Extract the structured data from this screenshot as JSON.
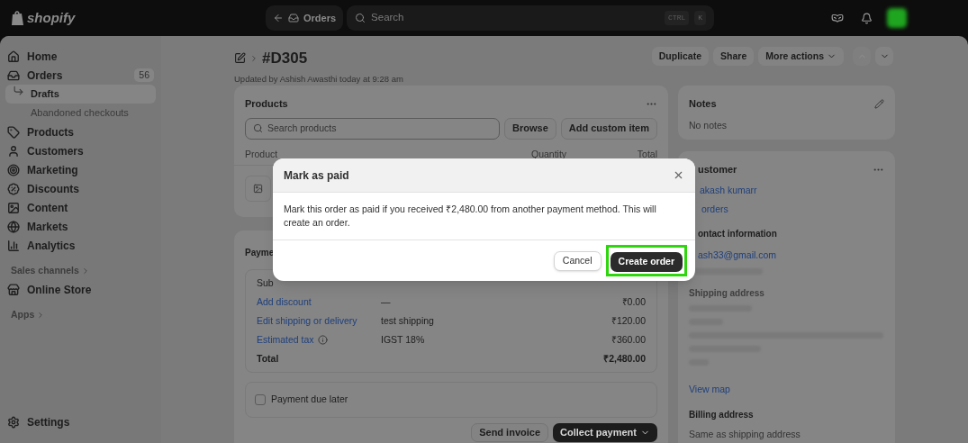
{
  "topbar": {
    "brand": "shopify",
    "back_label": "Orders",
    "search": {
      "placeholder": "Search"
    },
    "shortcut": [
      "CTRL",
      "K"
    ]
  },
  "sidebar": {
    "items": [
      {
        "label": "Home",
        "selected": false
      },
      {
        "label": "Orders",
        "badge": "56",
        "selected": false,
        "children": [
          {
            "label": "Drafts",
            "selected": true
          },
          {
            "label": "Abandoned checkouts",
            "selected": false
          }
        ]
      },
      {
        "label": "Products",
        "selected": false
      },
      {
        "label": "Customers",
        "selected": false
      },
      {
        "label": "Marketing",
        "selected": false
      },
      {
        "label": "Discounts",
        "selected": false
      },
      {
        "label": "Content",
        "selected": false
      },
      {
        "label": "Markets",
        "selected": false
      },
      {
        "label": "Analytics",
        "selected": false
      }
    ],
    "sections": [
      {
        "label": "Sales channels",
        "items": [
          {
            "label": "Online Store",
            "selected": false
          }
        ]
      },
      {
        "label": "Apps"
      }
    ],
    "footer_item": {
      "label": "Settings",
      "selected": false
    }
  },
  "header": {
    "title": "#D305",
    "subtitle": "Updated by Ashish Awasthi today at 9:28 am",
    "actions": [
      {
        "label": "Duplicate",
        "menu": false
      },
      {
        "label": "Share",
        "menu": false
      },
      {
        "label": "More actions",
        "menu": true
      }
    ],
    "prev": {
      "disabled": true
    },
    "next": {
      "disabled": false
    }
  },
  "products": {
    "title": "Products",
    "search": {
      "placeholder": "Search products"
    },
    "buttons": [
      "Browse",
      "Add custom item"
    ],
    "columns": [
      "Product",
      "Quantity",
      "Total"
    ]
  },
  "payment": {
    "title": "Payme",
    "rows": [
      {
        "kind": "plain",
        "label": "Sub"
      },
      {
        "kind": "link",
        "label": "Add discount",
        "detail": "—",
        "amount": "₹0.00"
      },
      {
        "kind": "link",
        "label": "Edit shipping or delivery",
        "detail": "test shipping",
        "amount": "₹120.00"
      },
      {
        "kind": "link",
        "label": "Estimated tax",
        "info": true,
        "detail": "IGST 18%",
        "amount": "₹360.00"
      },
      {
        "kind": "total",
        "label": "Total",
        "amount": "₹2,480.00"
      }
    ],
    "due_later": {
      "label": "Payment due later",
      "checked": false
    },
    "send_label": "Send invoice",
    "collect_label": "Collect payment"
  },
  "notes": {
    "title": "Notes",
    "text": "No notes"
  },
  "customer": {
    "title": "ustomer",
    "name": "akash kumarr",
    "orders": "orders",
    "contact_heading": "ontact information",
    "email": "ash33@gmail.com",
    "shipping_heading": "Shipping address",
    "map_link": "View map",
    "billing_heading": "Billing address",
    "billing_text": "Same as shipping address"
  },
  "modal": {
    "title": "Mark as paid",
    "body": "Mark this order as paid if you received ₹2,480.00 from another payment method. This will create an order.",
    "cancel": "Cancel",
    "confirm": "Create order",
    "confirm_highlighted": true
  }
}
